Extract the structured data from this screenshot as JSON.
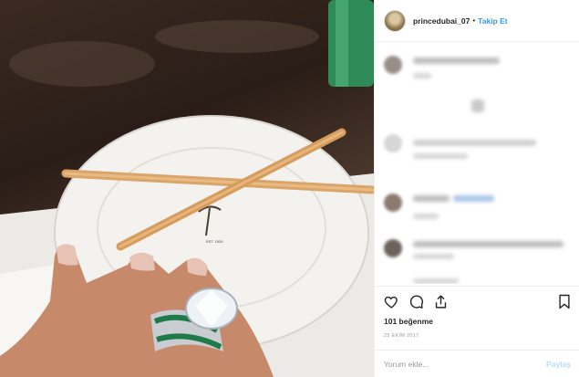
{
  "header": {
    "username": "princedubai_07",
    "separator": "•",
    "follow_label": "Takip Et"
  },
  "photo": {
    "plate_mark": "EST. 1929"
  },
  "post": {
    "likes": "101 beğenme",
    "date": "25 EKİM 2017"
  },
  "compose": {
    "placeholder": "Yorum ekle...",
    "post_label": "Paylaş"
  },
  "icons": {
    "like": "heart-icon",
    "comment": "comment-icon",
    "share": "share-icon",
    "save": "bookmark-icon"
  },
  "colors": {
    "accent": "#3897f0",
    "post_disabled": "#b2dffc",
    "emerald": "#1f7a4a"
  }
}
